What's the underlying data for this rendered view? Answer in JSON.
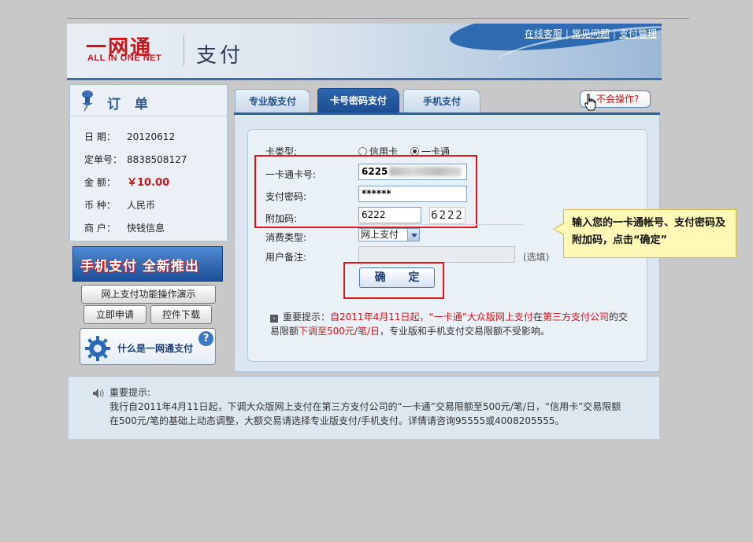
{
  "header": {
    "logo_cn": "一网通",
    "logo_en": "ALL IN ONE NET",
    "title": "支付",
    "links": [
      "在线客服",
      "常见问题",
      "支付管理"
    ]
  },
  "order": {
    "title": "订 单",
    "rows": [
      {
        "label": "日  期：",
        "value": "20120612"
      },
      {
        "label": "定单号：",
        "value": "8838508127"
      },
      {
        "label": "金  额：",
        "value": "￥10.00"
      },
      {
        "label": "币  种：",
        "value": "人民币"
      },
      {
        "label": "商  户：",
        "value": "快钱信息"
      }
    ]
  },
  "left": {
    "banner": "手机支付 全新推出",
    "demo_button": "网上支付功能操作演示",
    "apply_button": "立即申请",
    "download_button": "控件下载",
    "what_label": "什么是一网通支付",
    "what_q": "?"
  },
  "tabs": [
    "专业版支付",
    "卡号密码支付",
    "手机支付"
  ],
  "help_label": "不会操作?",
  "form": {
    "card_type_label": "卡类型:",
    "card_type_options": [
      "信用卡",
      "一卡通"
    ],
    "card_type_selected": "一卡通",
    "card_no_label": "一卡通卡号:",
    "card_no_value": "6225",
    "password_label": "支付密码:",
    "password_value": "******",
    "extra_code_label": "附加码:",
    "extra_code_value": "6222",
    "captcha": "6222",
    "consume_type_label": "消费类型:",
    "consume_type_value": "网上支付",
    "remark_label": "用户备注:",
    "remark_hint": "(选填)",
    "confirm_button": "确 定"
  },
  "tip": {
    "prefix": "重要提示：",
    "p1": "自",
    "date": "2011年4月11日起，",
    "p2": "“一卡通”大众版网上支付",
    "p3": "在",
    "p4": "第三方支付公司",
    "p5": "的交易限额",
    "limit": "下调至500元/笔/日",
    "p6": "，专业版和手机支付交易限额不受影响。"
  },
  "callout": "输入您的一卡通帐号、支付密码及附加码，点击“确定”",
  "notice": {
    "title": "重要提示:",
    "body": "我行自2011年4月11日起，下调大众版网上支付在第三方支付公司的“一卡通”交易限额至500元/笔/日，“信用卡”交易限额在500元/笔的基础上动态调整，大额交易请选择专业版支付/手机支付。详情请咨询95555或4008205555。"
  },
  "colors": {
    "brand_red": "#c8171d",
    "brand_blue": "#2a60a8"
  }
}
